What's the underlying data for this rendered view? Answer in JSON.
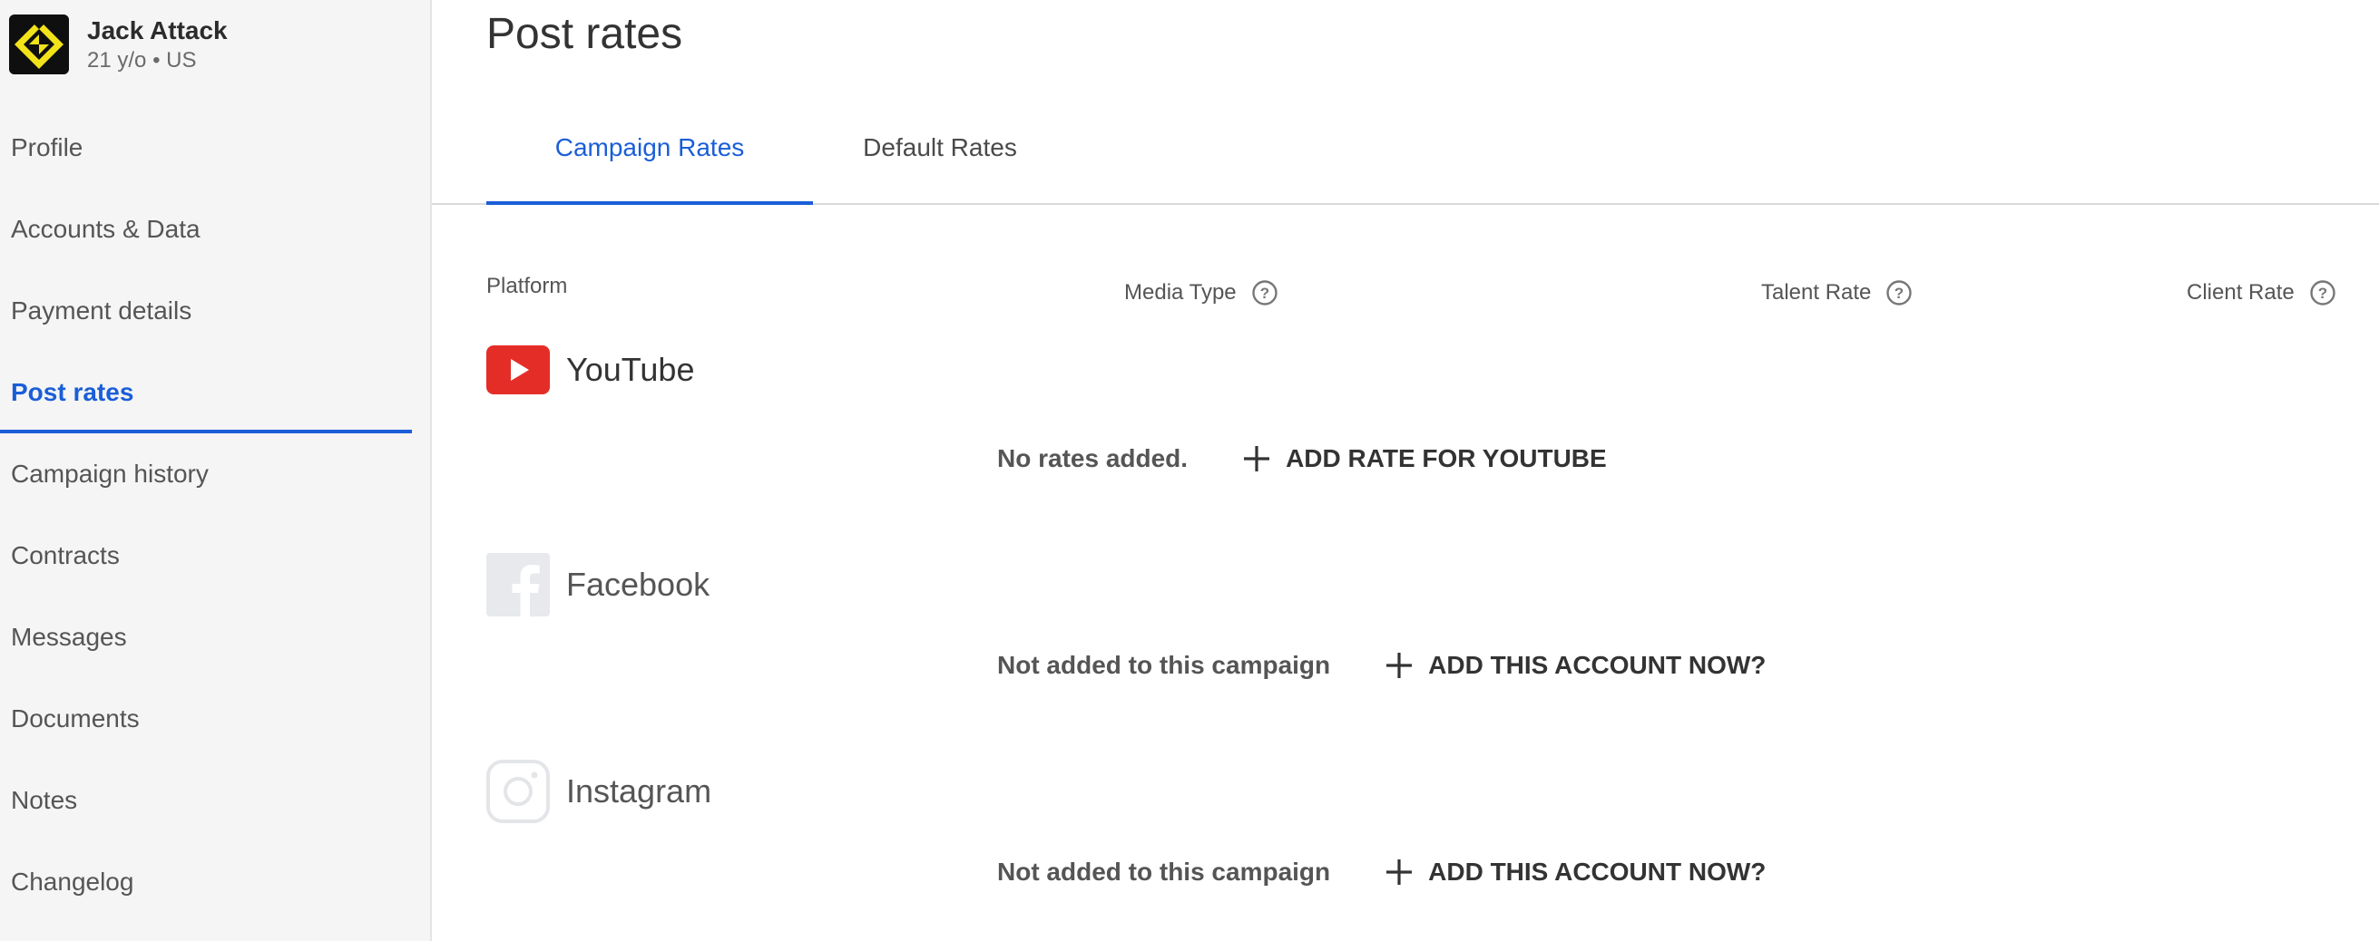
{
  "profile": {
    "name": "Jack Attack",
    "age": "21 y/o",
    "country": "US"
  },
  "nav": {
    "items": [
      {
        "label": "Profile"
      },
      {
        "label": "Accounts & Data"
      },
      {
        "label": "Payment details"
      },
      {
        "label": "Post rates",
        "active": true
      },
      {
        "label": "Campaign history"
      },
      {
        "label": "Contracts"
      },
      {
        "label": "Messages"
      },
      {
        "label": "Documents"
      },
      {
        "label": "Notes"
      },
      {
        "label": "Changelog"
      }
    ]
  },
  "page": {
    "title": "Post rates"
  },
  "tabs": [
    {
      "label": "Campaign Rates",
      "active": true
    },
    {
      "label": "Default Rates",
      "active": false
    }
  ],
  "columns": {
    "platform": "Platform",
    "media_type": "Media Type",
    "talent_rate": "Talent Rate",
    "client_rate": "Client Rate"
  },
  "platforms": [
    {
      "name": "YouTube",
      "icon": "youtube-icon",
      "status": "No rates added.",
      "action": "ADD RATE FOR YOUTUBE"
    },
    {
      "name": "Facebook",
      "icon": "facebook-icon",
      "status": "Not added to this campaign",
      "action": "ADD THIS ACCOUNT NOW?"
    },
    {
      "name": "Instagram",
      "icon": "instagram-icon",
      "status": "Not added to this campaign",
      "action": "ADD THIS ACCOUNT NOW?"
    }
  ],
  "colors": {
    "accent": "#1a5ed8",
    "youtube": "#e52d27",
    "sidebar_bg": "#f5f5f5",
    "logo_yellow": "#f2e21a"
  }
}
